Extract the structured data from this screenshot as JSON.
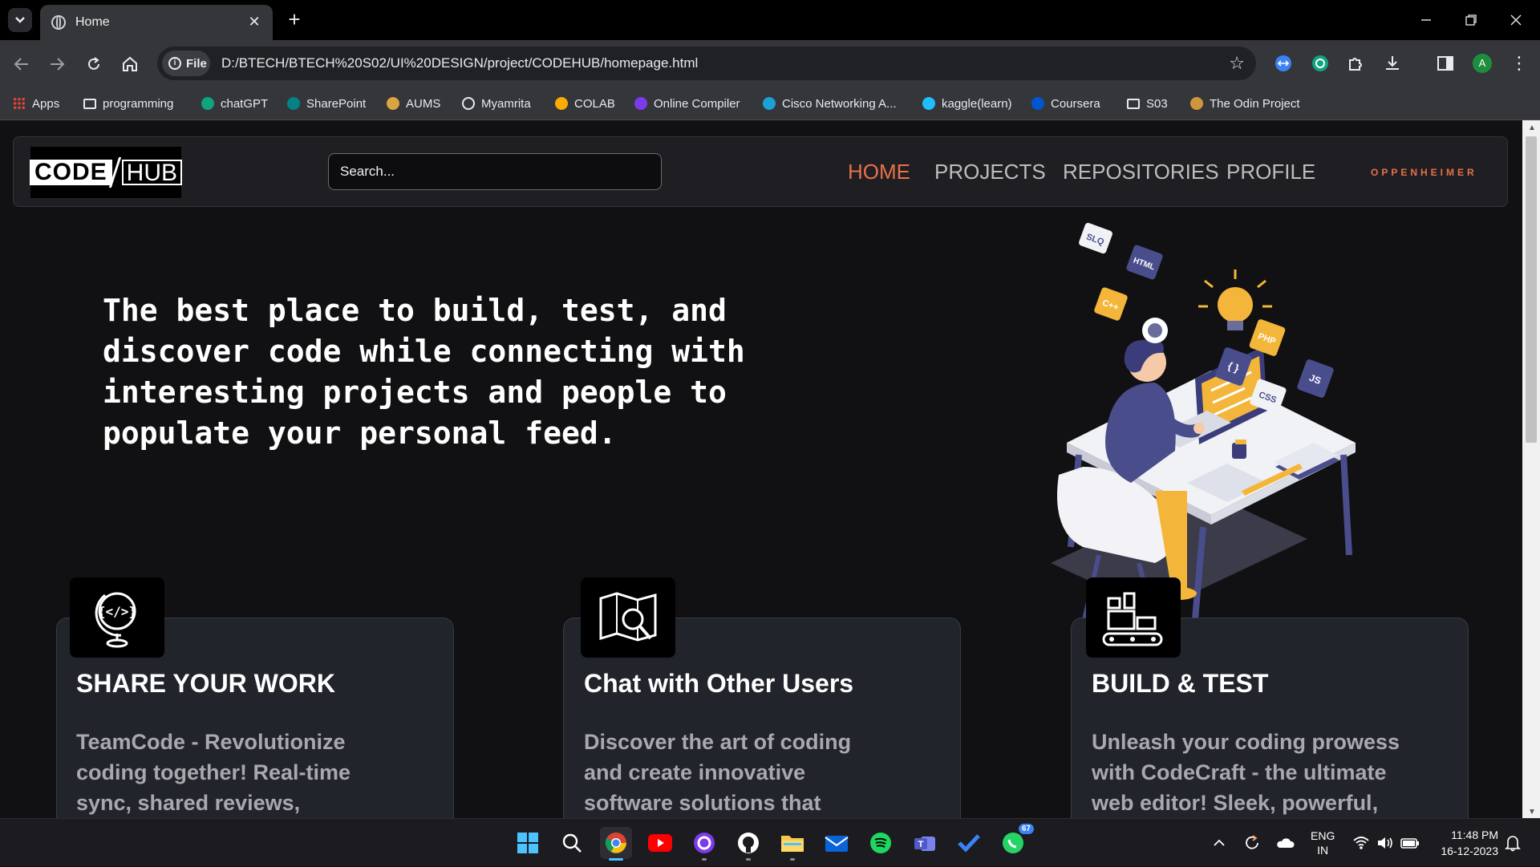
{
  "browser": {
    "tab_title": "Home",
    "address_chip": "File",
    "url": "D:/BTECH/BTECH%20S02/UI%20DESIGN/project/CODEHUB/homepage.html",
    "profile_initial": "A",
    "bookmarks": [
      {
        "label": "Apps",
        "icon": "apps-grid-icon",
        "color": "#ea4335"
      },
      {
        "label": "programming",
        "icon": "folder-icon",
        "color": "#e8eaed"
      },
      {
        "label": "chatGPT",
        "icon": "chatgpt-icon",
        "color": "#10a37f"
      },
      {
        "label": "SharePoint",
        "icon": "sharepoint-icon",
        "color": "#038387"
      },
      {
        "label": "AUMS",
        "icon": "aums-icon",
        "color": "#d9a441"
      },
      {
        "label": "Myamrita",
        "icon": "globe-icon",
        "color": "#e8eaed"
      },
      {
        "label": "COLAB",
        "icon": "colab-icon",
        "color": "#f9ab00"
      },
      {
        "label": "Online Compiler",
        "icon": "compiler-icon",
        "color": "#7c3aed"
      },
      {
        "label": "Cisco Networking A...",
        "icon": "cisco-icon",
        "color": "#1ba0d7"
      },
      {
        "label": "kaggle(learn)",
        "icon": "kaggle-icon",
        "color": "#20beff"
      },
      {
        "label": "Coursera",
        "icon": "coursera-icon",
        "color": "#0056d2"
      },
      {
        "label": "S03",
        "icon": "folder-icon",
        "color": "#e8eaed"
      },
      {
        "label": "The Odin Project",
        "icon": "odin-icon",
        "color": "#ce973e"
      }
    ]
  },
  "site": {
    "logo_left": "CODE",
    "logo_right": "HUB",
    "search_placeholder": "Search...",
    "nav": [
      {
        "label": "HOME",
        "active": true
      },
      {
        "label": "PROJECTS",
        "active": false
      },
      {
        "label": "REPOSITORIES",
        "active": false
      },
      {
        "label": "PROFILE",
        "active": false
      }
    ],
    "username": "OPPENHEIMER",
    "accent_color": "#e8704a",
    "hero_lines": [
      "The best place to build, test, and",
      "discover code while connecting with",
      "interesting projects and people to",
      "populate your personal feed."
    ],
    "illustration_tags": [
      "SLQ",
      "HTML",
      "C++",
      "PHP",
      "JS",
      "CSS",
      "{ }"
    ],
    "cards": [
      {
        "title": "SHARE YOUR WORK",
        "icon": "globe-code-icon",
        "lines": [
          "TeamCode - Revolutionize",
          "coding together! Real-time",
          "sync, shared reviews,"
        ]
      },
      {
        "title": "Chat with Other Users",
        "icon": "map-search-icon",
        "lines": [
          "Discover the art of coding",
          "and create innovative",
          "software solutions that"
        ]
      },
      {
        "title": "BUILD & TEST",
        "icon": "conveyor-blocks-icon",
        "lines": [
          "Unleash your coding prowess",
          "with CodeCraft - the ultimate",
          "web editor! Sleek, powerful,"
        ]
      }
    ]
  },
  "taskbar": {
    "whatsapp_badge": "67",
    "language": "ENG",
    "region": "IN",
    "time": "11:48 PM",
    "date": "16-12-2023"
  }
}
